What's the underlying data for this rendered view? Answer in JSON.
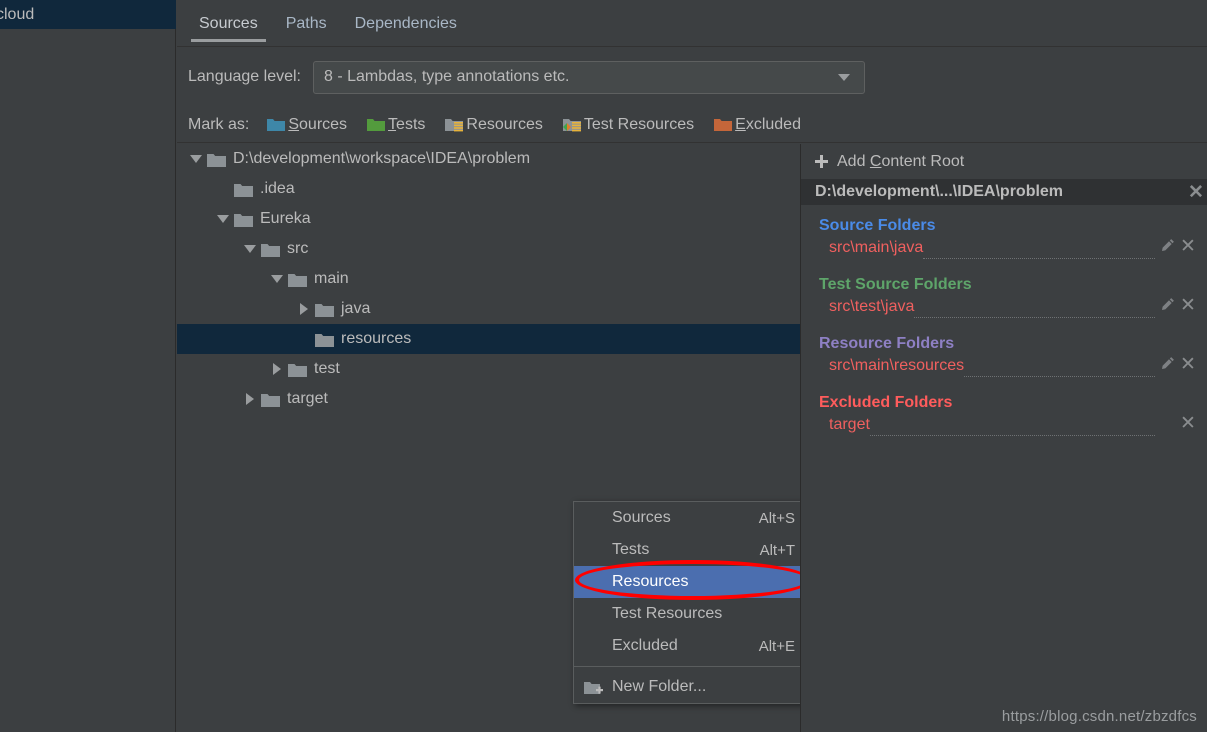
{
  "sidebar": {
    "selected_item": "cloud"
  },
  "tabs": [
    {
      "label": "Sources",
      "active": true
    },
    {
      "label": "Paths",
      "active": false
    },
    {
      "label": "Dependencies",
      "active": false
    }
  ],
  "language_level": {
    "label": "Language level:",
    "value": "8 - Lambdas, type annotations etc.",
    "caret_icon": "chevron-down-icon"
  },
  "mark_as": {
    "label": "Mark as:",
    "items": [
      {
        "label": "Sources",
        "mnemonic": "S",
        "rest": "ources",
        "icon": "folder-sources-icon",
        "color": "#3E87A8"
      },
      {
        "label": "Tests",
        "mnemonic": "T",
        "rest": "ests",
        "icon": "folder-tests-icon",
        "color": "#539B3D"
      },
      {
        "label": "Resources",
        "mnemonic": "",
        "rest": "Resources",
        "icon": "folder-resources-icon",
        "color": "#8C9296"
      },
      {
        "label": "Test Resources",
        "mnemonic": "",
        "rest": "Test Resources",
        "icon": "folder-test-resources-icon",
        "color": "#8C9296"
      },
      {
        "label": "Excluded",
        "mnemonic": "E",
        "rest": "xcluded",
        "icon": "folder-excluded-icon",
        "color": "#C4663A"
      }
    ]
  },
  "tree": [
    {
      "label": "D:\\development\\workspace\\IDEA\\problem",
      "depth": 0,
      "twisty": "down",
      "selected": false
    },
    {
      "label": ".idea",
      "depth": 1,
      "twisty": "none",
      "selected": false
    },
    {
      "label": "Eureka",
      "depth": 1,
      "twisty": "down",
      "selected": false
    },
    {
      "label": "src",
      "depth": 2,
      "twisty": "down",
      "selected": false
    },
    {
      "label": "main",
      "depth": 3,
      "twisty": "down",
      "selected": false
    },
    {
      "label": "java",
      "depth": 4,
      "twisty": "right",
      "selected": false
    },
    {
      "label": "resources",
      "depth": 4,
      "twisty": "none",
      "selected": true
    },
    {
      "label": "test",
      "depth": 3,
      "twisty": "right",
      "selected": false
    },
    {
      "label": "target",
      "depth": 2,
      "twisty": "right",
      "selected": false
    }
  ],
  "context_menu": {
    "items": [
      {
        "label": "Sources",
        "accel": "Alt+S",
        "highlighted": false,
        "icon": null
      },
      {
        "label": "Tests",
        "accel": "Alt+T",
        "highlighted": false,
        "icon": null
      },
      {
        "label": "Resources",
        "accel": "",
        "highlighted": true,
        "icon": null
      },
      {
        "label": "Test Resources",
        "accel": "",
        "highlighted": false,
        "icon": null
      },
      {
        "label": "Excluded",
        "accel": "Alt+E",
        "highlighted": false,
        "icon": null
      }
    ],
    "new_folder": {
      "label": "New Folder...",
      "icon": "folder-add-icon"
    },
    "highlight_color": "#4B6EAF",
    "annotation": {
      "shape": "ellipse",
      "color": "#FF0000",
      "around": "Resources"
    }
  },
  "right_panel": {
    "add_content_root": {
      "label_before": "Add ",
      "mnemonic": "C",
      "label_after": "ontent Root",
      "icon": "plus-icon"
    },
    "content_root": {
      "path": "D:\\development\\...\\IDEA\\problem",
      "close_icon": "close-icon"
    },
    "sections": [
      {
        "title": "Source Folders",
        "color": "#4A8BE8",
        "entries": [
          {
            "path": "src\\main\\java",
            "edit_icon": "pencil-icon",
            "remove_icon": "close-icon",
            "has_edit": true
          }
        ]
      },
      {
        "title": "Test Source Folders",
        "color": "#5EA56A",
        "entries": [
          {
            "path": "src\\test\\java",
            "edit_icon": "pencil-icon",
            "remove_icon": "close-icon",
            "has_edit": true
          }
        ]
      },
      {
        "title": "Resource Folders",
        "color": "#8E80C4",
        "entries": [
          {
            "path": "src\\main\\resources",
            "edit_icon": "pencil-icon",
            "remove_icon": "close-icon",
            "has_edit": true
          }
        ]
      },
      {
        "title": "Excluded Folders",
        "color": "#FF5C5C",
        "entries": [
          {
            "path": "target",
            "edit_icon": null,
            "remove_icon": "close-icon",
            "has_edit": false
          }
        ]
      }
    ],
    "entry_color": "#F0605F"
  },
  "watermark": "https://blog.csdn.net/zbzdfcs"
}
